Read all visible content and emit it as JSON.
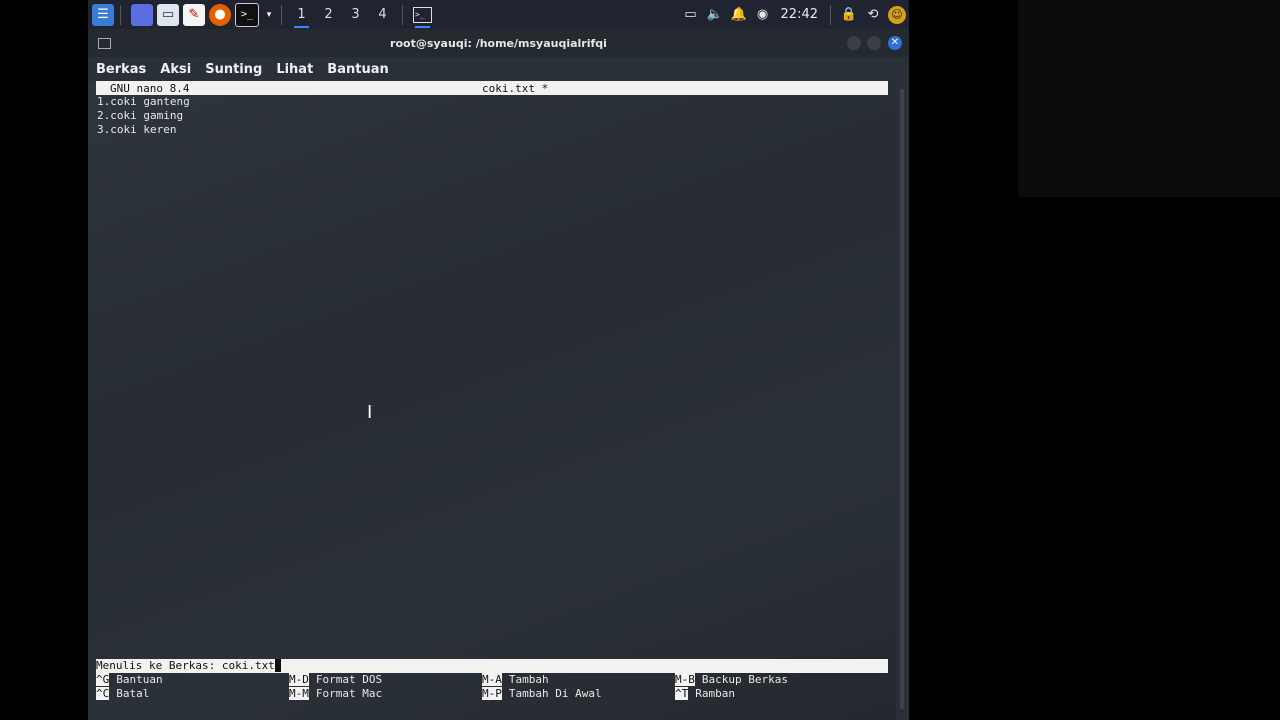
{
  "taskbar": {
    "workspaces": [
      "1",
      "2",
      "3",
      "4"
    ],
    "clock": "22:42"
  },
  "window": {
    "title": "root@syauqi: /home/msyauqialrifqi",
    "menu": [
      "Berkas",
      "Aksi",
      "Sunting",
      "Lihat",
      "Bantuan"
    ]
  },
  "nano": {
    "version": "GNU nano 8.4",
    "filename": "coki.txt *",
    "lines": [
      "1.coki ganteng",
      "2.coki gaming",
      "3.coki keren"
    ],
    "prompt": "Menulis ke Berkas: coki.txt",
    "shortcuts": [
      {
        "key": "^G",
        "label": "Bantuan"
      },
      {
        "key": "M-D",
        "label": "Format DOS"
      },
      {
        "key": "M-A",
        "label": "Tambah"
      },
      {
        "key": "M-B",
        "label": "Backup Berkas"
      },
      {
        "key": "^C",
        "label": "Batal"
      },
      {
        "key": "M-M",
        "label": "Format Mac"
      },
      {
        "key": "M-P",
        "label": "Tambah Di Awal"
      },
      {
        "key": "^T",
        "label": "Ramban"
      }
    ]
  },
  "colors": {
    "taskbar_bg": "#1f2430",
    "accent": "#3a86ff",
    "close_button": "#2e6fd8",
    "nano_bar": "#f2f2f2"
  }
}
